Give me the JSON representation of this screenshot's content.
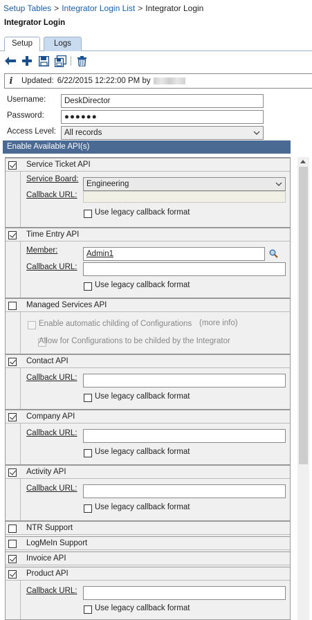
{
  "breadcrumb": {
    "items": [
      "Setup Tables",
      "Integrator Login List"
    ],
    "current": "Integrator Login",
    "separator": ">"
  },
  "page_title": "Integrator Login",
  "tabs": [
    {
      "label": "Setup",
      "active": true
    },
    {
      "label": "Logs",
      "active": false
    }
  ],
  "toolbar": {
    "icons": [
      "back-arrow-icon",
      "add-icon",
      "save-icon",
      "save-and-new-icon",
      "delete-icon"
    ]
  },
  "info": {
    "updated_label": "Updated:",
    "updated_value": "6/22/2015  12:22:00 PM by"
  },
  "form": {
    "username_label": "Username:",
    "username_value": "DeskDirector",
    "password_label": "Password:",
    "password_value": "●●●●●●",
    "access_label": "Access Level:",
    "access_value": "All records"
  },
  "api_header": "Enable Available API(s)",
  "sections": {
    "service_ticket": {
      "title": "Service Ticket API",
      "checked": true,
      "board_label": "Service Board:",
      "board_value": "Engineering",
      "callback_label": "Callback URL:",
      "callback_value": "",
      "legacy_label": "Use legacy callback format"
    },
    "time_entry": {
      "title": "Time Entry API",
      "checked": true,
      "member_label": "Member:",
      "member_value": "Admin1",
      "callback_label": "Callback URL:",
      "callback_value": "",
      "legacy_label": "Use legacy callback format"
    },
    "managed": {
      "title": "Managed Services API",
      "checked": false,
      "opt1": "Enable automatic childing of Configurations",
      "more_info": "(more info)",
      "opt2": "Allow for Configurations to be childed by the Integrator"
    },
    "contact": {
      "title": "Contact API",
      "checked": true,
      "callback_label": "Callback URL:",
      "callback_value": "",
      "legacy_label": "Use legacy callback format"
    },
    "company": {
      "title": "Company API",
      "checked": true,
      "callback_label": "Callback URL:",
      "callback_value": "",
      "legacy_label": "Use legacy callback format"
    },
    "activity": {
      "title": "Activity API",
      "checked": true,
      "callback_label": "Callback URL:",
      "callback_value": "",
      "legacy_label": "Use legacy callback format"
    },
    "ntr": {
      "title": "NTR Support",
      "checked": false
    },
    "logmein": {
      "title": "LogMeIn Support",
      "checked": false
    },
    "invoice": {
      "title": "Invoice API",
      "checked": true
    },
    "product": {
      "title": "Product API",
      "checked": true,
      "callback_label": "Callback URL:",
      "callback_value": "",
      "legacy_label": "Use legacy callback format"
    }
  },
  "colors": {
    "link": "#1c5fa8",
    "api_bar": "#4a6a93",
    "tab_inactive": "#c9dcef",
    "panel_bg": "#f0f0f0"
  }
}
